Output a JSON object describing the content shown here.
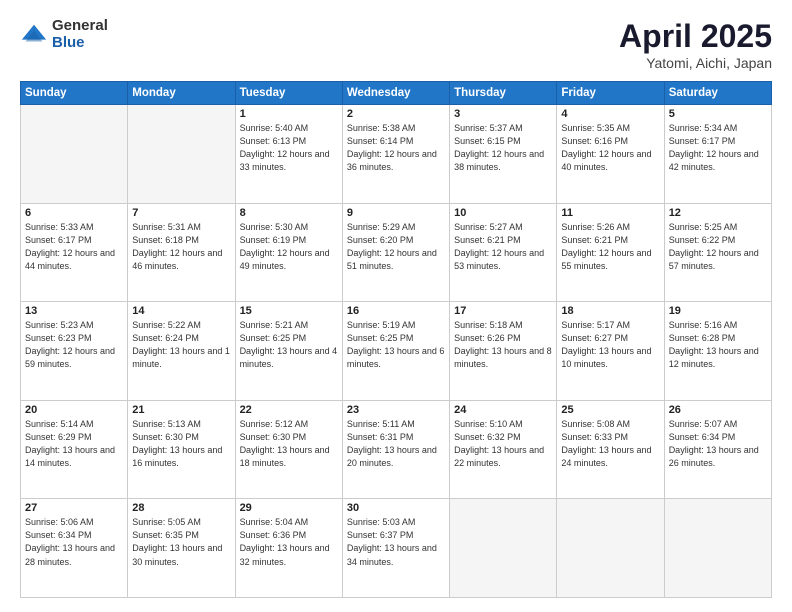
{
  "header": {
    "logo_general": "General",
    "logo_blue": "Blue",
    "month_title": "April 2025",
    "location": "Yatomi, Aichi, Japan"
  },
  "weekdays": [
    "Sunday",
    "Monday",
    "Tuesday",
    "Wednesday",
    "Thursday",
    "Friday",
    "Saturday"
  ],
  "weeks": [
    [
      {
        "day": "",
        "info": ""
      },
      {
        "day": "",
        "info": ""
      },
      {
        "day": "1",
        "info": "Sunrise: 5:40 AM\nSunset: 6:13 PM\nDaylight: 12 hours and 33 minutes."
      },
      {
        "day": "2",
        "info": "Sunrise: 5:38 AM\nSunset: 6:14 PM\nDaylight: 12 hours and 36 minutes."
      },
      {
        "day": "3",
        "info": "Sunrise: 5:37 AM\nSunset: 6:15 PM\nDaylight: 12 hours and 38 minutes."
      },
      {
        "day": "4",
        "info": "Sunrise: 5:35 AM\nSunset: 6:16 PM\nDaylight: 12 hours and 40 minutes."
      },
      {
        "day": "5",
        "info": "Sunrise: 5:34 AM\nSunset: 6:17 PM\nDaylight: 12 hours and 42 minutes."
      }
    ],
    [
      {
        "day": "6",
        "info": "Sunrise: 5:33 AM\nSunset: 6:17 PM\nDaylight: 12 hours and 44 minutes."
      },
      {
        "day": "7",
        "info": "Sunrise: 5:31 AM\nSunset: 6:18 PM\nDaylight: 12 hours and 46 minutes."
      },
      {
        "day": "8",
        "info": "Sunrise: 5:30 AM\nSunset: 6:19 PM\nDaylight: 12 hours and 49 minutes."
      },
      {
        "day": "9",
        "info": "Sunrise: 5:29 AM\nSunset: 6:20 PM\nDaylight: 12 hours and 51 minutes."
      },
      {
        "day": "10",
        "info": "Sunrise: 5:27 AM\nSunset: 6:21 PM\nDaylight: 12 hours and 53 minutes."
      },
      {
        "day": "11",
        "info": "Sunrise: 5:26 AM\nSunset: 6:21 PM\nDaylight: 12 hours and 55 minutes."
      },
      {
        "day": "12",
        "info": "Sunrise: 5:25 AM\nSunset: 6:22 PM\nDaylight: 12 hours and 57 minutes."
      }
    ],
    [
      {
        "day": "13",
        "info": "Sunrise: 5:23 AM\nSunset: 6:23 PM\nDaylight: 12 hours and 59 minutes."
      },
      {
        "day": "14",
        "info": "Sunrise: 5:22 AM\nSunset: 6:24 PM\nDaylight: 13 hours and 1 minute."
      },
      {
        "day": "15",
        "info": "Sunrise: 5:21 AM\nSunset: 6:25 PM\nDaylight: 13 hours and 4 minutes."
      },
      {
        "day": "16",
        "info": "Sunrise: 5:19 AM\nSunset: 6:25 PM\nDaylight: 13 hours and 6 minutes."
      },
      {
        "day": "17",
        "info": "Sunrise: 5:18 AM\nSunset: 6:26 PM\nDaylight: 13 hours and 8 minutes."
      },
      {
        "day": "18",
        "info": "Sunrise: 5:17 AM\nSunset: 6:27 PM\nDaylight: 13 hours and 10 minutes."
      },
      {
        "day": "19",
        "info": "Sunrise: 5:16 AM\nSunset: 6:28 PM\nDaylight: 13 hours and 12 minutes."
      }
    ],
    [
      {
        "day": "20",
        "info": "Sunrise: 5:14 AM\nSunset: 6:29 PM\nDaylight: 13 hours and 14 minutes."
      },
      {
        "day": "21",
        "info": "Sunrise: 5:13 AM\nSunset: 6:30 PM\nDaylight: 13 hours and 16 minutes."
      },
      {
        "day": "22",
        "info": "Sunrise: 5:12 AM\nSunset: 6:30 PM\nDaylight: 13 hours and 18 minutes."
      },
      {
        "day": "23",
        "info": "Sunrise: 5:11 AM\nSunset: 6:31 PM\nDaylight: 13 hours and 20 minutes."
      },
      {
        "day": "24",
        "info": "Sunrise: 5:10 AM\nSunset: 6:32 PM\nDaylight: 13 hours and 22 minutes."
      },
      {
        "day": "25",
        "info": "Sunrise: 5:08 AM\nSunset: 6:33 PM\nDaylight: 13 hours and 24 minutes."
      },
      {
        "day": "26",
        "info": "Sunrise: 5:07 AM\nSunset: 6:34 PM\nDaylight: 13 hours and 26 minutes."
      }
    ],
    [
      {
        "day": "27",
        "info": "Sunrise: 5:06 AM\nSunset: 6:34 PM\nDaylight: 13 hours and 28 minutes."
      },
      {
        "day": "28",
        "info": "Sunrise: 5:05 AM\nSunset: 6:35 PM\nDaylight: 13 hours and 30 minutes."
      },
      {
        "day": "29",
        "info": "Sunrise: 5:04 AM\nSunset: 6:36 PM\nDaylight: 13 hours and 32 minutes."
      },
      {
        "day": "30",
        "info": "Sunrise: 5:03 AM\nSunset: 6:37 PM\nDaylight: 13 hours and 34 minutes."
      },
      {
        "day": "",
        "info": ""
      },
      {
        "day": "",
        "info": ""
      },
      {
        "day": "",
        "info": ""
      }
    ]
  ]
}
